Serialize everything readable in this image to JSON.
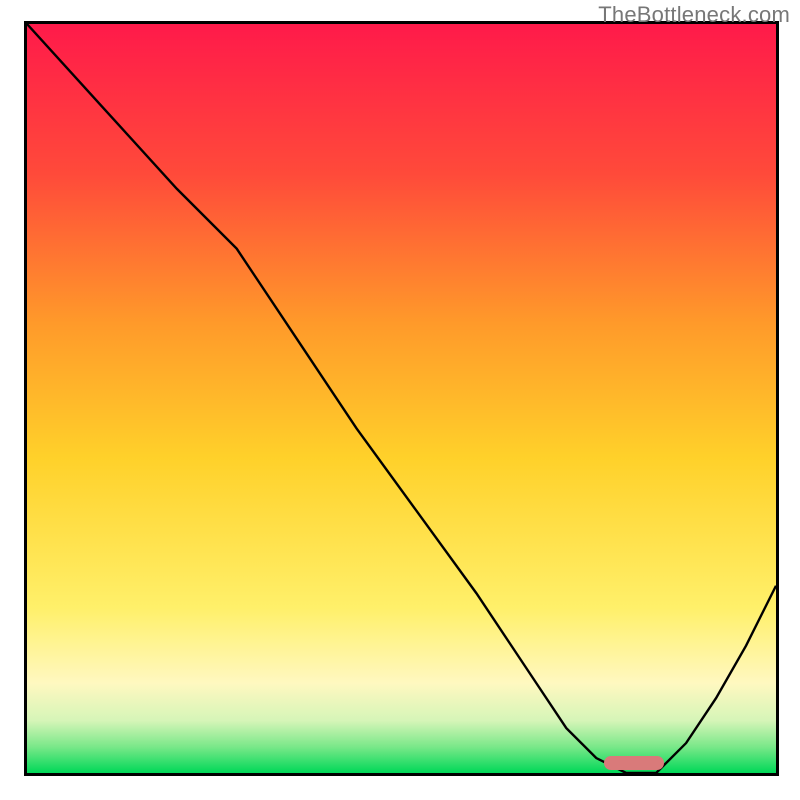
{
  "watermark": "TheBottleneck.com",
  "colors": {
    "gradient_top": "#ff1a4a",
    "gradient_mid_upper": "#ff7a2e",
    "gradient_mid": "#ffd12a",
    "gradient_lower_pale": "#fff59a",
    "gradient_pale_green": "#c9f5b0",
    "gradient_green": "#00e060",
    "curve_stroke": "#000000",
    "marker_fill": "#d97a7a",
    "border": "#000000"
  },
  "chart_data": {
    "type": "line",
    "title": "",
    "xlabel": "",
    "ylabel": "",
    "xlim": [
      0,
      100
    ],
    "ylim": [
      0,
      100
    ],
    "grid": false,
    "series": [
      {
        "name": "bottleneck-curve",
        "x": [
          0,
          10,
          20,
          28,
          36,
          44,
          52,
          60,
          68,
          72,
          76,
          80,
          84,
          88,
          92,
          96,
          100
        ],
        "y": [
          100,
          89,
          78,
          70,
          58,
          46,
          35,
          24,
          12,
          6,
          2,
          0,
          0,
          4,
          10,
          17,
          25
        ]
      }
    ],
    "annotations": [
      {
        "name": "optimal-range-marker",
        "x_start": 77,
        "x_end": 85,
        "y": 1.4
      }
    ],
    "background_gradient_stops": [
      {
        "offset": 0.0,
        "color": "#ff1a4a"
      },
      {
        "offset": 0.2,
        "color": "#ff4a3a"
      },
      {
        "offset": 0.4,
        "color": "#ff9a2a"
      },
      {
        "offset": 0.58,
        "color": "#ffd12a"
      },
      {
        "offset": 0.78,
        "color": "#fff06a"
      },
      {
        "offset": 0.88,
        "color": "#fff8c0"
      },
      {
        "offset": 0.93,
        "color": "#d6f5b8"
      },
      {
        "offset": 0.965,
        "color": "#7ae889"
      },
      {
        "offset": 1.0,
        "color": "#00d858"
      }
    ]
  }
}
